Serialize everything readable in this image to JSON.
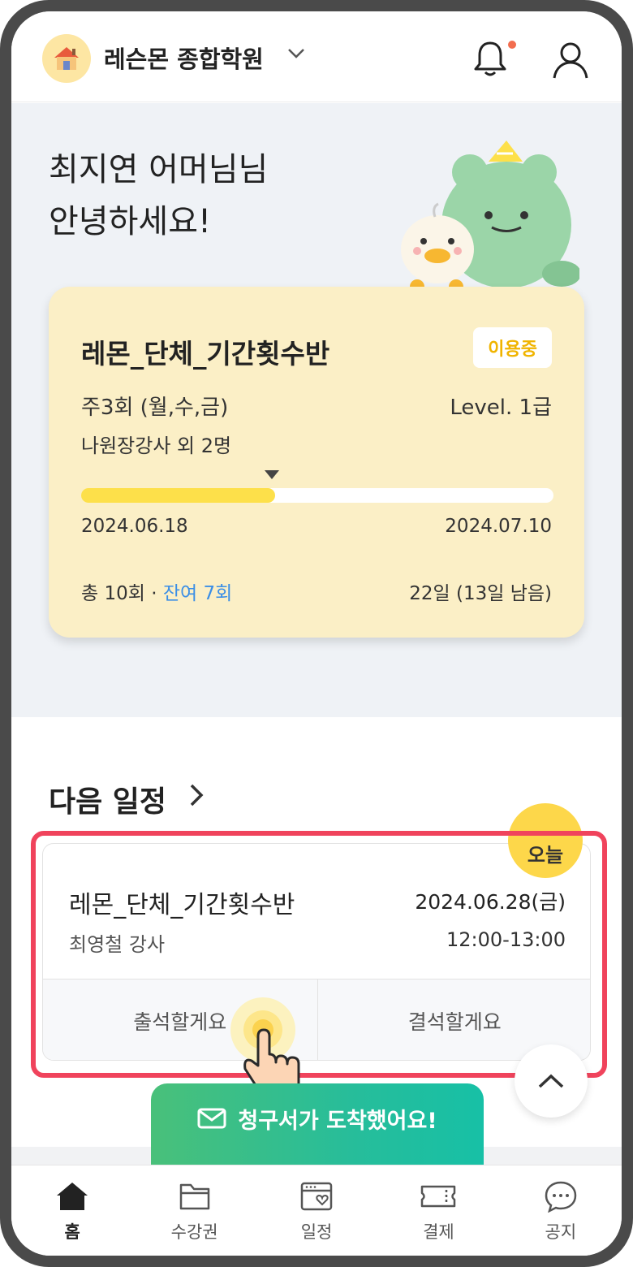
{
  "header": {
    "academy_name": "레슨몬 종합학원"
  },
  "greeting": {
    "line1": "최지연 어머님님",
    "line2": "안녕하세요!"
  },
  "pass": {
    "title": "레몬_단체_기간횟수반",
    "status": "이용중",
    "schedule": "주3회 (월,수,금)",
    "level": "Level. 1급",
    "teachers": "나원장강사 외 2명",
    "progress_fraction": 0.41,
    "start_date": "2024.06.18",
    "end_date": "2024.07.10",
    "sessions_total": "총 10회 · ",
    "sessions_remaining": "잔여 7회",
    "days": "22일 (13일 남음)"
  },
  "next_schedule": {
    "section_title": "다음 일정",
    "today_badge": "오늘",
    "event": {
      "title": "레몬_단체_기간횟수반",
      "date": "2024.06.28(금)",
      "teacher": "최영철 강사",
      "time": "12:00-13:00",
      "attend_label": "출석할게요",
      "absent_label": "결석할게요"
    }
  },
  "invoice_button": {
    "label": "청구서가 도착했어요!"
  },
  "tabbar": {
    "items": [
      {
        "label": "홈",
        "icon": "home-icon"
      },
      {
        "label": "수강권",
        "icon": "folder-icon"
      },
      {
        "label": "일정",
        "icon": "calendar-icon"
      },
      {
        "label": "결제",
        "icon": "ticket-icon"
      },
      {
        "label": "공지",
        "icon": "chat-icon"
      }
    ]
  },
  "colors": {
    "accent_yellow": "#fde04a",
    "card_bg": "#fbefc6",
    "highlight_red": "#f0435c",
    "remain_blue": "#3a8ee6",
    "invoice_green": "#27bd9a"
  }
}
